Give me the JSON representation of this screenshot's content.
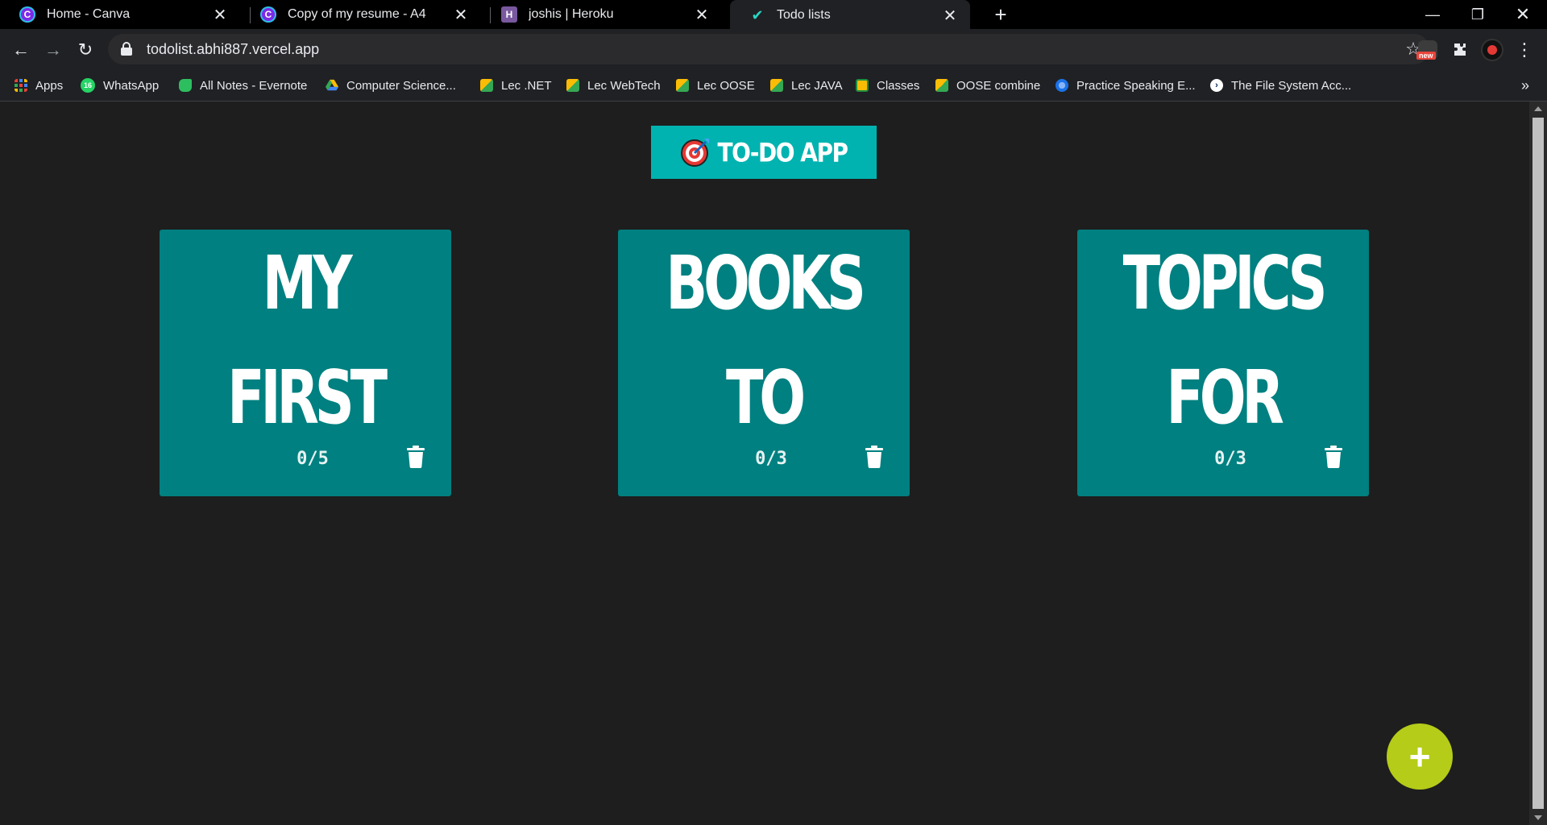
{
  "browser": {
    "tabs": [
      {
        "title": "Home - Canva",
        "favicon": "canva-icon"
      },
      {
        "title": "Copy of my resume - A4",
        "favicon": "canva-icon"
      },
      {
        "title": "joshis | Heroku",
        "favicon": "heroku-icon"
      },
      {
        "title": "Todo lists",
        "favicon": "todo-check-icon",
        "active": true
      }
    ],
    "url": "todolist.abhi887.vercel.app",
    "extension_badge": "new",
    "bookmarks": [
      {
        "label": "Apps",
        "icon": "apps-grid-icon"
      },
      {
        "label": "WhatsApp",
        "icon": "whatsapp-icon",
        "badge": "16"
      },
      {
        "label": "All Notes - Evernote",
        "icon": "evernote-icon"
      },
      {
        "label": "Computer Science...",
        "icon": "google-drive-icon"
      },
      {
        "label": "Lec .NET",
        "icon": "meet-icon"
      },
      {
        "label": "Lec WebTech",
        "icon": "meet-icon"
      },
      {
        "label": "Lec OOSE",
        "icon": "meet-icon"
      },
      {
        "label": "Lec JAVA",
        "icon": "meet-icon"
      },
      {
        "label": "Classes",
        "icon": "classroom-icon"
      },
      {
        "label": "OOSE combine",
        "icon": "meet-icon"
      },
      {
        "label": "Practice Speaking E...",
        "icon": "globe-icon"
      },
      {
        "label": "The File System Acc...",
        "icon": "powershell-icon"
      }
    ],
    "bookmarks_more": "»"
  },
  "app": {
    "title": "TO-DO APP",
    "lists": [
      {
        "title": "MY FIRST LIST",
        "count": "0/5"
      },
      {
        "title": "BOOKS TO READ",
        "count": "0/3"
      },
      {
        "title": "TOPICS FOR",
        "count": "0/3"
      }
    ],
    "fab_label": "+"
  },
  "colors": {
    "page_bg": "#1e1e1e",
    "header_bg": "#00b3b0",
    "card_bg": "#008080",
    "fab_bg": "#b5cc18"
  }
}
